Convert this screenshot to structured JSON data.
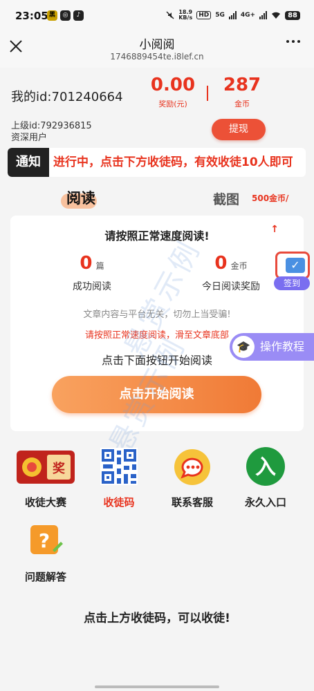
{
  "status_bar": {
    "time": "23:05",
    "app_icons": [
      "黑",
      "◎",
      "♪"
    ],
    "net_speed_top": "18.9",
    "net_speed_bottom": "KB/s",
    "hd_label": "HD",
    "signal_5g": "5G",
    "signal_4g": "4G+",
    "battery": "88"
  },
  "nav": {
    "title": "小阅阅",
    "url": "1746889454te.i8lef.cn"
  },
  "account": {
    "my_id_label": "我的id:701240664",
    "reward_value": "0.00",
    "reward_label": "奖励(元)",
    "coins_value": "287",
    "coins_label": "金币",
    "parent_id": "上级id:792936815",
    "user_type": "资深用户",
    "withdraw_label": "提现"
  },
  "notice": {
    "tag": "通知",
    "text": "进行中，点击下方收徒码，有效收徒10人即可"
  },
  "tabs": {
    "read": "阅读",
    "screenshot": "截图",
    "screenshot_reward": "500金币/"
  },
  "read_card": {
    "title": "请按照正常速度阅读!",
    "arrow": "↑",
    "success_count": "0",
    "success_unit": "篇",
    "success_label": "成功阅读",
    "today_reward": "0",
    "today_reward_unit": "金币",
    "today_reward_label": "今日阅读奖励",
    "disclaimer": "文章内容与平台无关，切勿上当受骗!",
    "warning": "请按照正常速度阅读，滑至文章底部",
    "start_hint": "点击下面按钮开始阅读",
    "start_button": "点击开始阅读"
  },
  "floating": {
    "signin_label": "签到",
    "tutorial_label": "操作教程"
  },
  "watermark": "悬赏示例",
  "features": [
    {
      "label": "收徒大赛",
      "icon": "contest-icon"
    },
    {
      "label": "收徒码",
      "icon": "qr-code-icon"
    },
    {
      "label": "联系客服",
      "icon": "chat-icon"
    },
    {
      "label": "永久入口",
      "icon": "enter-icon"
    },
    {
      "label": "问题解答",
      "icon": "question-icon"
    }
  ],
  "bottom_tip": "点击上方收徒码，可以收徒!",
  "colors": {
    "accent_red": "#e8331e",
    "button_orange": "#f07a36",
    "background": "#f4f4f4"
  }
}
